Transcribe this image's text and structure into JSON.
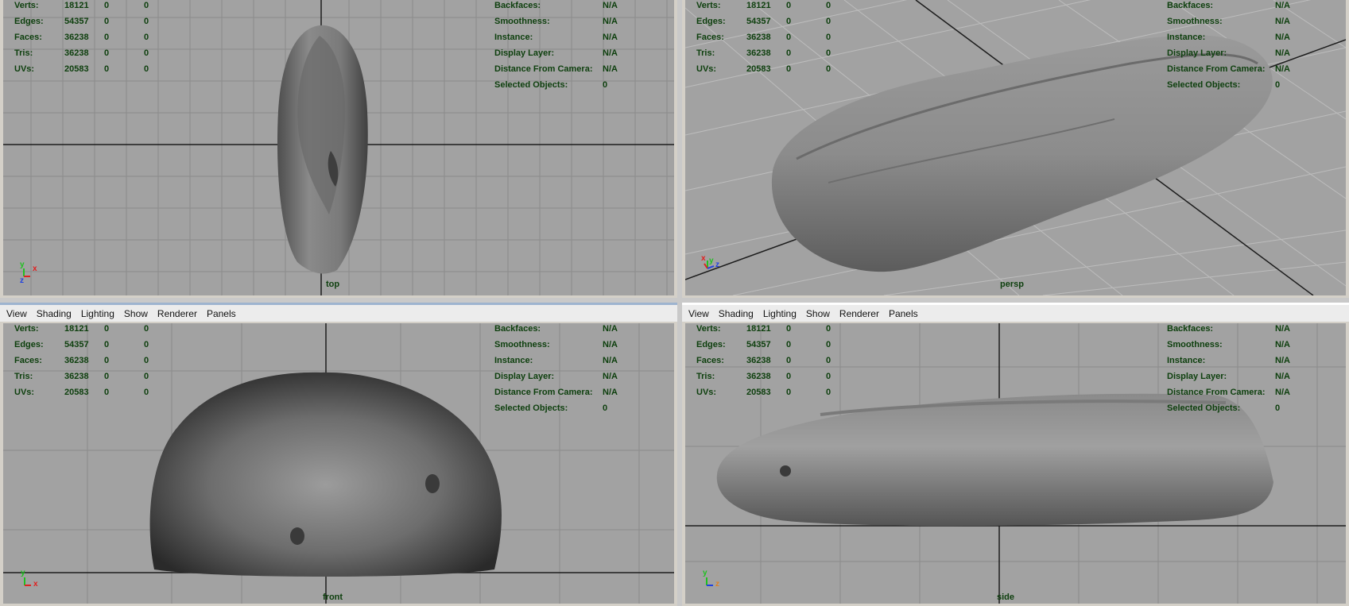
{
  "menu": [
    "View",
    "Shading",
    "Lighting",
    "Show",
    "Renderer",
    "Panels"
  ],
  "hud": {
    "stats": [
      {
        "label": "Verts:",
        "value": "18121",
        "a": "0",
        "b": "0"
      },
      {
        "label": "Edges:",
        "value": "54357",
        "a": "0",
        "b": "0"
      },
      {
        "label": "Faces:",
        "value": "36238",
        "a": "0",
        "b": "0"
      },
      {
        "label": "Tris:",
        "value": "36238",
        "a": "0",
        "b": "0"
      },
      {
        "label": "UVs:",
        "value": "20583",
        "a": "0",
        "b": "0"
      }
    ],
    "info": [
      {
        "label": "Backfaces:",
        "value": "N/A"
      },
      {
        "label": "Smoothness:",
        "value": "N/A"
      },
      {
        "label": "Instance:",
        "value": "N/A"
      },
      {
        "label": "Display Layer:",
        "value": "N/A"
      },
      {
        "label": "Distance From Camera:",
        "value": "N/A"
      },
      {
        "label": "Selected Objects:",
        "value": "0"
      }
    ]
  },
  "panels": {
    "top": {
      "camera": "top",
      "axes": [
        "y",
        "x",
        "z"
      ]
    },
    "persp": {
      "camera": "persp",
      "axes": [
        "x",
        "y",
        "z"
      ]
    },
    "front": {
      "camera": "front",
      "axes": [
        "y",
        "x"
      ]
    },
    "side": {
      "camera": "side",
      "axes": [
        "y",
        "z"
      ]
    }
  },
  "colors": {
    "viewport_bg": "#a2a2a2",
    "grid": "#8b8b8b",
    "axis_line": "#1c1c1c",
    "hud_text": "#0d3f0d",
    "axis_x": "#e02020",
    "axis_y": "#20c020",
    "axis_z": "#2040e0"
  }
}
